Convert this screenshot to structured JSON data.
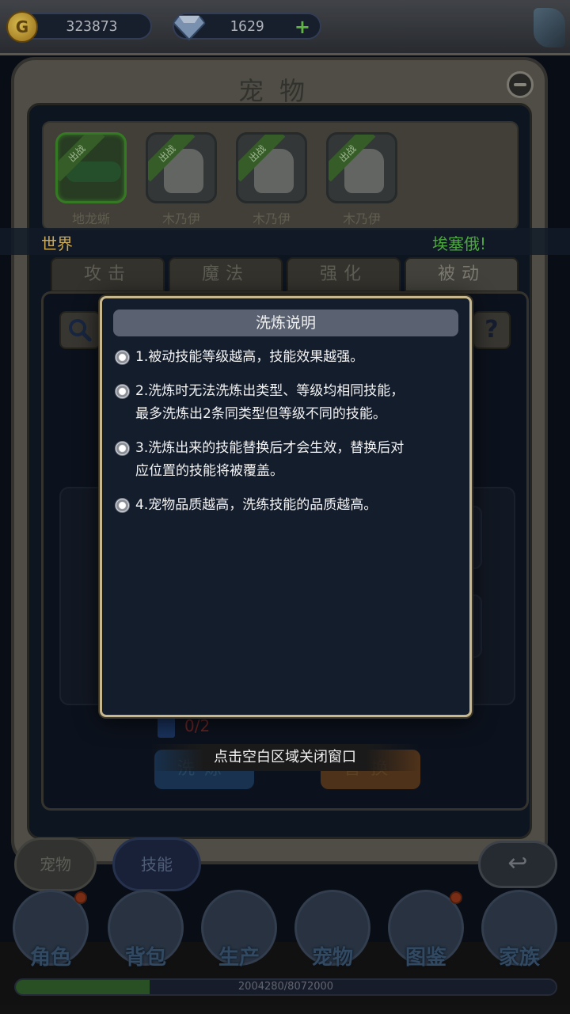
{
  "resources": {
    "gold": "323873",
    "gems": "1629",
    "gem_plus": "+"
  },
  "window": {
    "title": "宠物"
  },
  "pets": [
    {
      "name": "地龙蜥",
      "badge": "出战",
      "selected": true
    },
    {
      "name": "木乃伊",
      "badge": "出战",
      "selected": false
    },
    {
      "name": "木乃伊",
      "badge": "出战",
      "selected": false
    },
    {
      "name": "木乃伊",
      "badge": "出战",
      "selected": false
    }
  ],
  "chat": {
    "channel": "世界",
    "right_text": "埃塞俄!"
  },
  "tabs": [
    "攻击",
    "魔法",
    "强化",
    "被动"
  ],
  "active_tab": "被动",
  "help_label": "?",
  "refine": {
    "count": "0/2",
    "wash_label": "洗炼",
    "replace_label": "替换"
  },
  "close_hint": "点击空白区域关闭窗口",
  "modal": {
    "title": "洗炼说明",
    "rules": [
      [
        "1.被动技能等级越高，技能效果越强。"
      ],
      [
        "2.洗炼时无法洗炼出类型、等级均相同技能，",
        "最多洗炼出2条同类型但等级不同的技能。"
      ],
      [
        "3.洗炼出来的技能替换后才会生效，替换后对",
        "应位置的技能将被覆盖。"
      ],
      [
        "4.宠物品质越高，洗练技能的品质越高。"
      ]
    ]
  },
  "sub_tabs": {
    "pet": "宠物",
    "skill": "技能",
    "active": "技能"
  },
  "menu": [
    {
      "label": "角色",
      "icon": "character-icon",
      "badge": true
    },
    {
      "label": "背包",
      "icon": "backpack-icon",
      "badge": false
    },
    {
      "label": "生产",
      "icon": "pickaxe-icon",
      "badge": false
    },
    {
      "label": "宠物",
      "icon": "pet-icon",
      "badge": false
    },
    {
      "label": "图鉴",
      "icon": "book-icon",
      "badge": true
    },
    {
      "label": "家族",
      "icon": "guild-shield-icon",
      "badge": false
    }
  ],
  "xp": {
    "text": "2004280/8072000",
    "fraction": 0.248
  },
  "colors": {
    "modal_border": "#c8b890",
    "chat_channel": "#e8c060",
    "chat_name": "#58c048"
  }
}
